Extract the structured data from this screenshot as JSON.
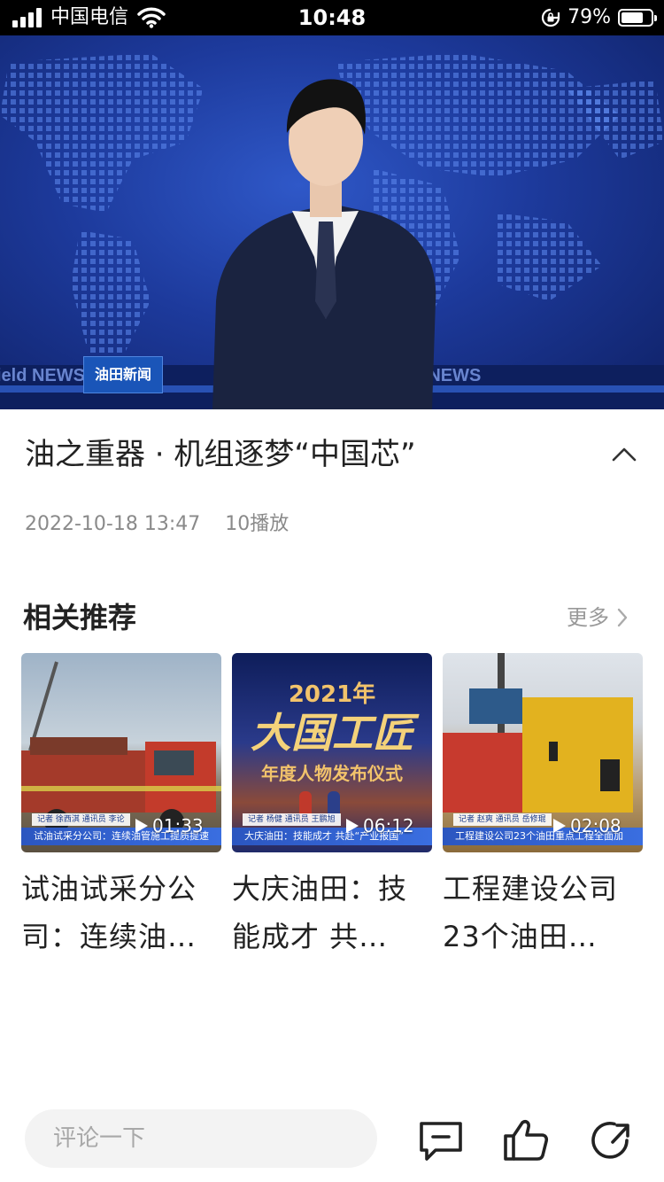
{
  "status_bar": {
    "carrier": "中国电信",
    "time": "10:48",
    "battery": "79%",
    "battery_level": 0.79
  },
  "video": {
    "station_logo": "油田新闻",
    "title": "油之重器 · 机组逐梦“中国芯”",
    "date": "2022-10-18 13:47",
    "plays": "10播放"
  },
  "related": {
    "heading": "相关推荐",
    "more": "更多",
    "items": [
      {
        "duration": "01:33",
        "title": "试油试采分公司：连续油…",
        "ticker": "试油试采分公司：连续油管施工提质提速",
        "reporter": "记者 徐西淇 通讯员 李论"
      },
      {
        "duration": "06:12",
        "title": "大庆油田：技能成才 共…",
        "ticker": "大庆油田：技能成才 共赴“产业报国”",
        "reporter": "记者 杨健 通讯员 王鹏旭",
        "banner_year": "2021年",
        "banner_title": "大国工匠",
        "banner_sub": "年度人物发布仪式"
      },
      {
        "duration": "02:08",
        "title": "工程建设公司23个油田…",
        "ticker": "工程建设公司23个油田重点工程全面加",
        "reporter": "记者 赵爽 通讯员 岳修琨"
      }
    ]
  },
  "bottom_bar": {
    "comment_placeholder": "评论一下"
  },
  "icons": [
    "signal-icon",
    "wifi-icon",
    "rotation-lock-icon",
    "battery-icon",
    "chevron-up-icon",
    "chevron-right-icon",
    "play-icon",
    "comment-icon",
    "like-icon",
    "share-icon"
  ],
  "colors": {
    "accent_blue": "#1d3a9c",
    "text_primary": "#222222",
    "text_secondary": "#8a8a8a"
  }
}
